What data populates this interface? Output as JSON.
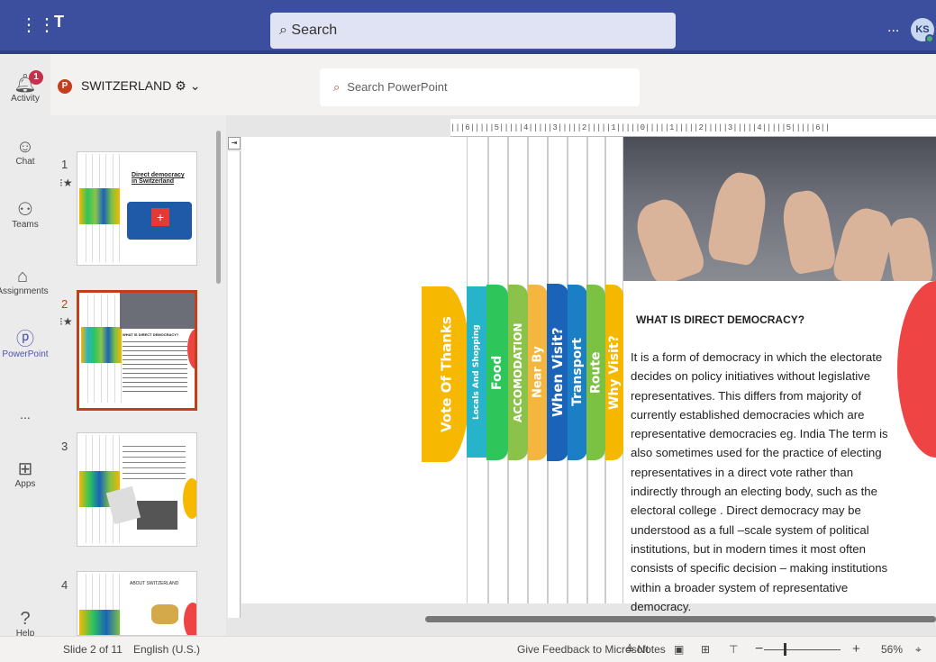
{
  "topbar": {
    "search_placeholder": "Search",
    "more": "...",
    "avatar_initials": "KS"
  },
  "rail": [
    {
      "label": "Activity",
      "icon": "bell-icon",
      "badge": "1"
    },
    {
      "label": "Chat",
      "icon": "chat-icon"
    },
    {
      "label": "Teams",
      "icon": "teams-icon"
    },
    {
      "label": "Assignments",
      "icon": "assignments-icon"
    },
    {
      "label": "PowerPoint",
      "icon": "powerpoint-icon",
      "active": true
    },
    {
      "label": "...",
      "icon": "more-icon"
    },
    {
      "label": "Apps",
      "icon": "apps-icon"
    },
    {
      "label": "Help",
      "icon": "help-icon"
    }
  ],
  "doc": {
    "title": "SWITZERLAND",
    "search_placeholder": "Search PowerPoint"
  },
  "thumbnails": [
    {
      "num": "1",
      "title": "Direct democracy in Switzerland"
    },
    {
      "num": "2",
      "title": "WHAT IS DIRECT DEMOCRACY?"
    },
    {
      "num": "3",
      "title": ""
    },
    {
      "num": "4",
      "title": "ABOUT SWITZERLAND"
    }
  ],
  "ruler": "|||6|||||5|||||4|||||3|||||2|||||1|||||0|||||1|||||2|||||3|||||4|||||5|||||6||",
  "tabs": [
    {
      "label": "Vote Of Thanks",
      "color": "#f6b800"
    },
    {
      "label": "Locals And Shopping",
      "color": "#27b3c9"
    },
    {
      "label": "Food",
      "color": "#2ec55b"
    },
    {
      "label": "ACCOMODATION",
      "color": "#8bc34a"
    },
    {
      "label": "Near By",
      "color": "#f4b63e"
    },
    {
      "label": "When Visit?",
      "color": "#1a63b8"
    },
    {
      "label": "Transport",
      "color": "#1a7fc4"
    },
    {
      "label": "Route",
      "color": "#7cc242"
    },
    {
      "label": "Why Visit?",
      "color": "#f5b700"
    }
  ],
  "slide": {
    "heading": "WHAT IS DIRECT DEMOCRACY?",
    "body": "It is a form of democracy in which the electorate decides on policy initiatives without legislative representatives. This  differs from majority of currently established democracies which are representative democracies eg. India  The term is also sometimes used for the practice of electing representatives in a direct vote rather than indirectly through an electing body, such as the electoral college . Direct democracy may be understood as a full –scale system of political institutions, but in modern times it most often consists of specific decision – making institutions within a broader system of representative democracy."
  },
  "status": {
    "slide": "Slide 2 of 11",
    "language": "English (U.S.)",
    "feedback": "Give Feedback to Microsoft",
    "notes": "Notes",
    "zoom": "56%",
    "minus": "−",
    "plus": "+"
  }
}
